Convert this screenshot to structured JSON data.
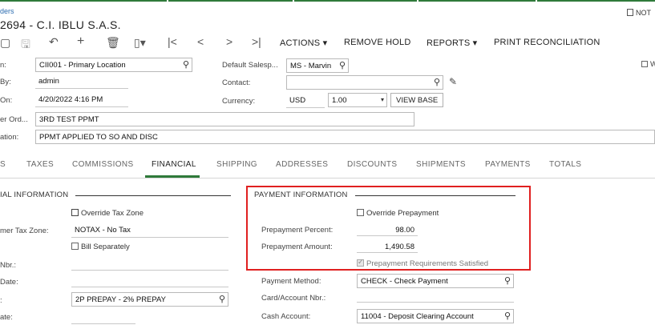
{
  "header": {
    "breadcrumb": "ders",
    "title": "2694 - C.I. IBLU S.A.S.",
    "notes_label": "NOT"
  },
  "toolbar": {
    "actions": "ACTIONS",
    "remove_hold": "REMOVE HOLD",
    "reports": "REPORTS",
    "print_reconciliation": "PRINT RECONCILIATION"
  },
  "form": {
    "location_label": "n:",
    "location_value": "CII001 - Primary Location",
    "created_by_label": "By:",
    "created_by_value": "admin",
    "created_on_label": "On:",
    "created_on_value": "4/20/2022 4:16 PM",
    "customer_order_label": "er Ord...",
    "customer_order_value": "3RD TEST PPMT",
    "description_label": "ation:",
    "description_value": "PPMT APPLIED TO SO AND DISC",
    "salesperson_label": "Default Salesp...",
    "salesperson_value": "MS - Marvin",
    "contact_label": "Contact:",
    "contact_value": "",
    "currency_label": "Currency:",
    "currency_value": "USD",
    "rate_value": "1.00",
    "view_base": "VIEW BASE",
    "right_edge_label": "W"
  },
  "tabs": [
    "S",
    "TAXES",
    "COMMISSIONS",
    "FINANCIAL",
    "SHIPPING",
    "ADDRESSES",
    "DISCOUNTS",
    "SHIPMENTS",
    "PAYMENTS",
    "TOTALS"
  ],
  "financial": {
    "section_title": "IAL INFORMATION",
    "override_tax_zone": "Override Tax Zone",
    "tax_zone_label": "mer Tax Zone:",
    "tax_zone_value": "NOTAX - No Tax",
    "bill_separately": "Bill Separately",
    "nbr_label": "Nbr.:",
    "date_label": "Date:",
    "terms_label": ":",
    "terms_value": "2P PREPAY - 2% PREPAY",
    "ate_label": "ate:"
  },
  "payment": {
    "section_title": "PAYMENT INFORMATION",
    "override_prepayment": "Override Prepayment",
    "prepayment_percent_label": "Prepayment Percent:",
    "prepayment_percent_value": "98.00",
    "prepayment_amount_label": "Prepayment Amount:",
    "prepayment_amount_value": "1,490.58",
    "requirements_satisfied": "Prepayment Requirements Satisfied",
    "payment_method_label": "Payment Method:",
    "payment_method_value": "CHECK - Check Payment",
    "card_account_label": "Card/Account Nbr.:",
    "cash_account_label": "Cash Account:",
    "cash_account_value": "11004 - Deposit Clearing Account"
  },
  "colors": {
    "accent_green": "#2f7a3a",
    "highlight_red": "#e02020",
    "link_blue": "#2b6cb0"
  }
}
